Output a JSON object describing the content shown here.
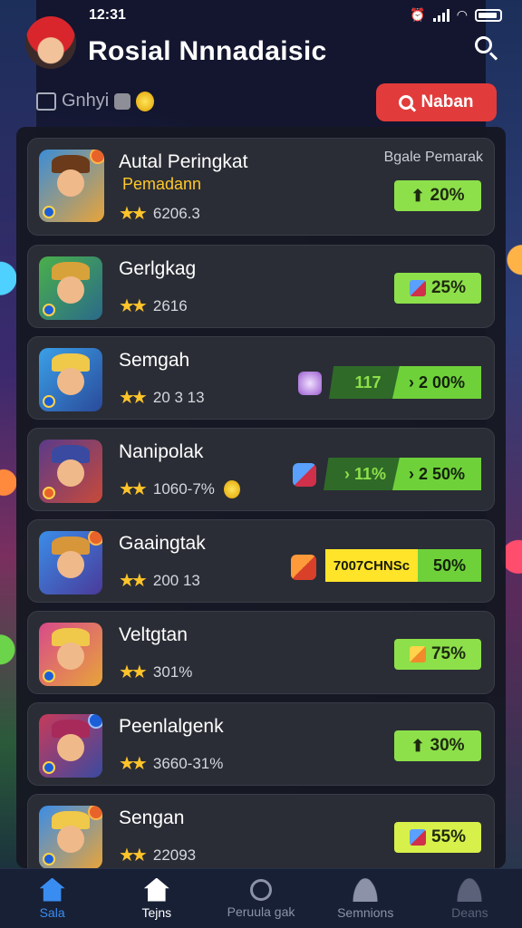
{
  "status_bar": {
    "time": "12:31"
  },
  "header": {
    "app_title": "Rosial  Nnnadaisic"
  },
  "subbar": {
    "left_label": "Gnhyi",
    "action_label": "Naban"
  },
  "list": [
    {
      "title": "Autal Peringkat",
      "subtitle": "Pemadann",
      "rating": "6206.3",
      "corner_label": "Bgale Pemarak",
      "value": "20%",
      "style": "green-up"
    },
    {
      "title": "Gerlgkag",
      "rating": "2616",
      "value": "25%",
      "style": "green-cube"
    },
    {
      "title": "Semgah",
      "rating": "20 3 13",
      "seg1": "117",
      "value": "2 00%",
      "style": "split"
    },
    {
      "title": "Nanipolak",
      "rating": "1060-7%",
      "seg1": "11%",
      "value": "2 50%",
      "style": "split-cube"
    },
    {
      "title": "Gaaingtak",
      "rating": "200 13",
      "seg1": "7007CHNSc",
      "value": "50%",
      "style": "yellow"
    },
    {
      "title": "Veltgtan",
      "rating": "301%",
      "value": "75%",
      "style": "green-gold"
    },
    {
      "title": "Peenlalgenk",
      "rating": "3660-31%",
      "value": "30%",
      "style": "green-up"
    },
    {
      "title": "Sengan",
      "rating": "22093",
      "value": "55%",
      "style": "lime-cube"
    }
  ],
  "bottom_nav": [
    {
      "label": "Sala"
    },
    {
      "label": "Tejns"
    },
    {
      "label": "Peruula gak"
    },
    {
      "label": "Semnions"
    },
    {
      "label": "Deans"
    }
  ],
  "colors": {
    "accent_red": "#e23b3b",
    "accent_green": "#8de04a",
    "nav_active": "#3a8df0",
    "star": "#ffc42a"
  }
}
